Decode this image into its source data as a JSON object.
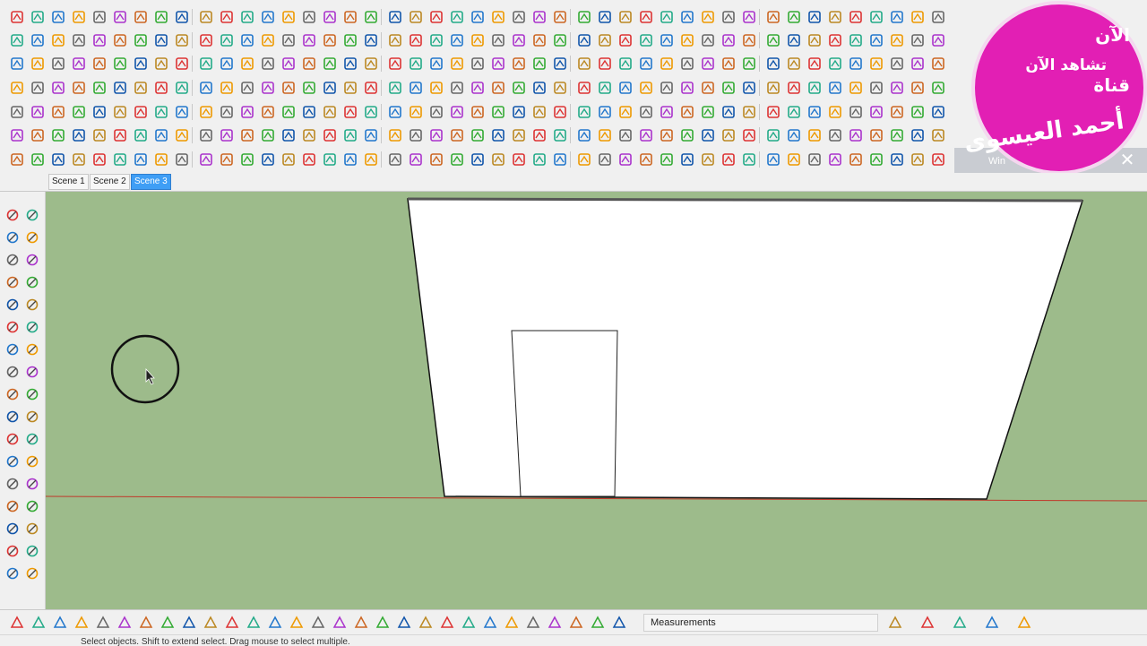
{
  "scenes": {
    "tabs": [
      "Scene 1",
      "Scene 2",
      "Scene 3"
    ],
    "active_index": 2
  },
  "measurements": {
    "label": "Measurements",
    "value": ""
  },
  "status": {
    "text": "Select objects. Shift to extend select. Drag mouse to select multiple."
  },
  "overlay": {
    "line1": "الآن",
    "line2": "تشاهد الآن",
    "line3": "قناة",
    "line4": "أحمد العيسوى",
    "partial_window_text": "Win"
  },
  "colors": {
    "viewport_bg": "#9dbb8b",
    "wall_fill": "#ffffff",
    "ground_axis": "#c0392b",
    "logo_bg": "#e21fb4",
    "active_tab": "#3f9ef5"
  },
  "icons": {
    "toolbar": [
      "select-icon",
      "undo-icon",
      "redo-icon",
      "paint-bucket-icon",
      "eraser-icon",
      "line-icon",
      "rectangle-icon",
      "circle-icon",
      "arc-icon",
      "push-pull-icon",
      "move-icon",
      "rotate-icon",
      "scale-icon",
      "offset-icon",
      "tape-measure-icon",
      "text-icon",
      "axes-icon",
      "orbit-icon",
      "pan-icon",
      "zoom-icon",
      "zoom-extents-icon",
      "help-icon",
      "section-icon",
      "shadow-icon"
    ],
    "left_tools": [
      "select-icon",
      "component-icon",
      "paint-bucket-icon",
      "eraser-icon",
      "line-icon",
      "freehand-icon",
      "rectangle-icon",
      "rotated-rectangle-icon",
      "circle-icon",
      "polygon-icon",
      "arc-icon",
      "pie-icon",
      "move-icon",
      "push-pull-icon",
      "rotate-icon",
      "follow-me-icon",
      "scale-icon",
      "offset-icon",
      "tape-measure-icon",
      "dimension-icon",
      "protractor-icon",
      "text-icon",
      "axes-icon",
      "3d-text-icon",
      "orbit-icon",
      "pan-icon",
      "zoom-icon",
      "zoom-window-icon",
      "zoom-extents-icon",
      "previous-view-icon",
      "position-camera-icon",
      "look-around-icon",
      "walk-icon",
      "section-plane-icon"
    ]
  }
}
